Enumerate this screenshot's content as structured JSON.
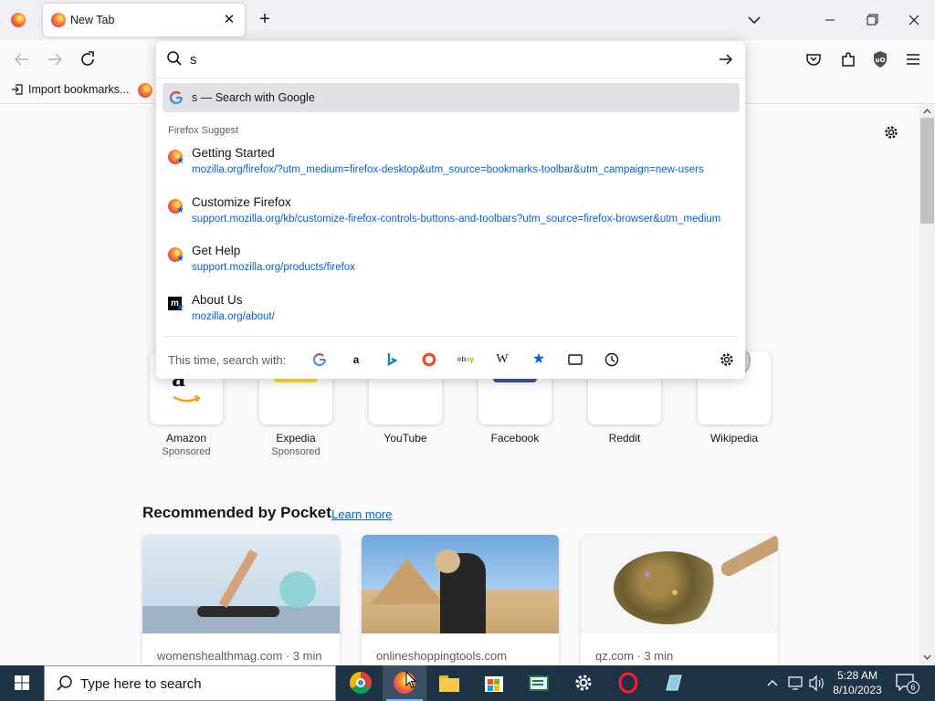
{
  "tab": {
    "title": "New Tab"
  },
  "bookmarks": {
    "import_label": "Import bookmarks..."
  },
  "urlbar": {
    "value": "s",
    "google_row": "s — Search with Google",
    "suggest_label": "Firefox Suggest",
    "suggestions": [
      {
        "title": "Getting Started",
        "url": "mozilla.org/firefox/?utm_medium=firefox-desktop&utm_source=bookmarks-toolbar&utm_campaign=new-users"
      },
      {
        "title": "Customize Firefox",
        "url": "support.mozilla.org/kb/customize-firefox-controls-buttons-and-toolbars?utm_source=firefox-browser&utm_medium"
      },
      {
        "title": "Get Help",
        "url": "support.mozilla.org/products/firefox"
      },
      {
        "title": "About Us",
        "url": "mozilla.org/about/"
      }
    ],
    "oneoff_label": "This time, search with:",
    "oneoff_engines": [
      "google-icon",
      "amazon-icon",
      "bing-icon",
      "duckduckgo-icon",
      "ebay-icon",
      "wikipedia-icon",
      "bookmarks-icon",
      "tabs-icon",
      "history-icon"
    ]
  },
  "top_sites": [
    {
      "name": "Amazon",
      "sponsored": "Sponsored"
    },
    {
      "name": "Expedia",
      "sponsored": "Sponsored"
    },
    {
      "name": "YouTube",
      "sponsored": ""
    },
    {
      "name": "Facebook",
      "sponsored": ""
    },
    {
      "name": "Reddit",
      "sponsored": ""
    },
    {
      "name": "Wikipedia",
      "sponsored": ""
    }
  ],
  "pocket": {
    "title": "Recommended by Pocket",
    "learn_more": "Learn more",
    "cards": [
      {
        "meta": "womenshealthmag.com · 3 min"
      },
      {
        "meta": "onlineshoppingtools.com"
      },
      {
        "meta": "qz.com · 3 min"
      }
    ]
  },
  "taskbar": {
    "search_placeholder": "Type here to search",
    "time": "5:28 AM",
    "date": "8/10/2023",
    "notification_count": "6"
  },
  "colors": {
    "accent": "#0061e0",
    "link": "#0060df",
    "taskbar": "#1f3346"
  }
}
